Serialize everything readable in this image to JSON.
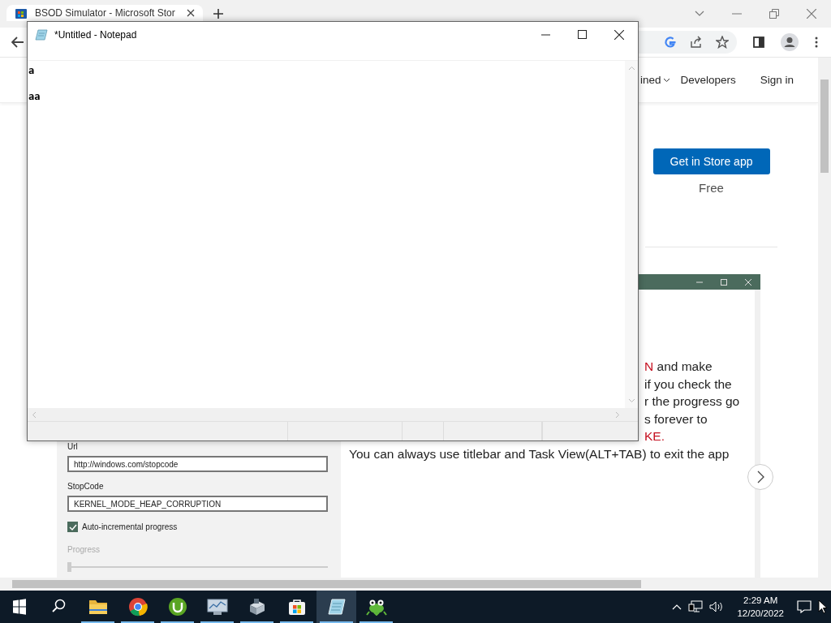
{
  "browser": {
    "tab": {
      "title": "BSOD Simulator - Microsoft Stor"
    },
    "nav": [
      {
        "label": "ined",
        "dropdown": true
      },
      {
        "label": "Developers",
        "dropdown": false
      },
      {
        "label": "Sign in",
        "dropdown": false
      }
    ],
    "product": {
      "button": "Get in Store app",
      "price": "Free"
    },
    "app_preview": {
      "text_lines": [
        {
          "clipped": true,
          "parts": [
            {
              "text": "N",
              "highlight": true
            },
            {
              "text": " and make",
              "highlight": false
            }
          ]
        },
        {
          "clipped": true,
          "parts": [
            {
              "text": "if you check the",
              "highlight": false
            }
          ]
        },
        {
          "clipped": true,
          "parts": [
            {
              "text": "r the progress go",
              "highlight": false
            }
          ]
        },
        {
          "clipped": true,
          "parts": [
            {
              "text": "s forever to",
              "highlight": false
            }
          ]
        },
        {
          "clipped": true,
          "parts": [
            {
              "text": "KE.",
              "highlight": true
            }
          ]
        },
        {
          "clipped": false,
          "parts": [
            {
              "text": "You can always use titlebar and Task View(ALT+TAB) to exit the app",
              "highlight": false
            }
          ]
        }
      ],
      "form": {
        "fields": [
          {
            "label": "Url",
            "value": "http://windows.com/stopcode"
          },
          {
            "label": "StopCode",
            "value": "KERNEL_MODE_HEAP_CORRUPTION"
          }
        ],
        "checkbox": {
          "label": "Auto-incremental progress",
          "checked": true
        },
        "slider": {
          "label": "Progress",
          "disabled": true,
          "level": 0.0
        }
      }
    }
  },
  "notepad": {
    "title": "*Untitled - Notepad",
    "text": "a\n\naa"
  },
  "taskbar": {
    "apps": [
      {
        "kind": "folder",
        "running": true,
        "selected": false
      },
      {
        "kind": "browser",
        "running": true,
        "selected": false
      },
      {
        "kind": "torrent",
        "running": true,
        "selected": false
      },
      {
        "kind": "monitor",
        "running": true,
        "selected": false
      },
      {
        "kind": "device",
        "running": true,
        "selected": false
      },
      {
        "kind": "store",
        "running": true,
        "selected": false
      },
      {
        "kind": "notepad",
        "running": true,
        "selected": true
      },
      {
        "kind": "frog",
        "running": true,
        "selected": false
      }
    ],
    "clock": {
      "time": "2:29 AM",
      "date": "12/20/2022"
    }
  }
}
